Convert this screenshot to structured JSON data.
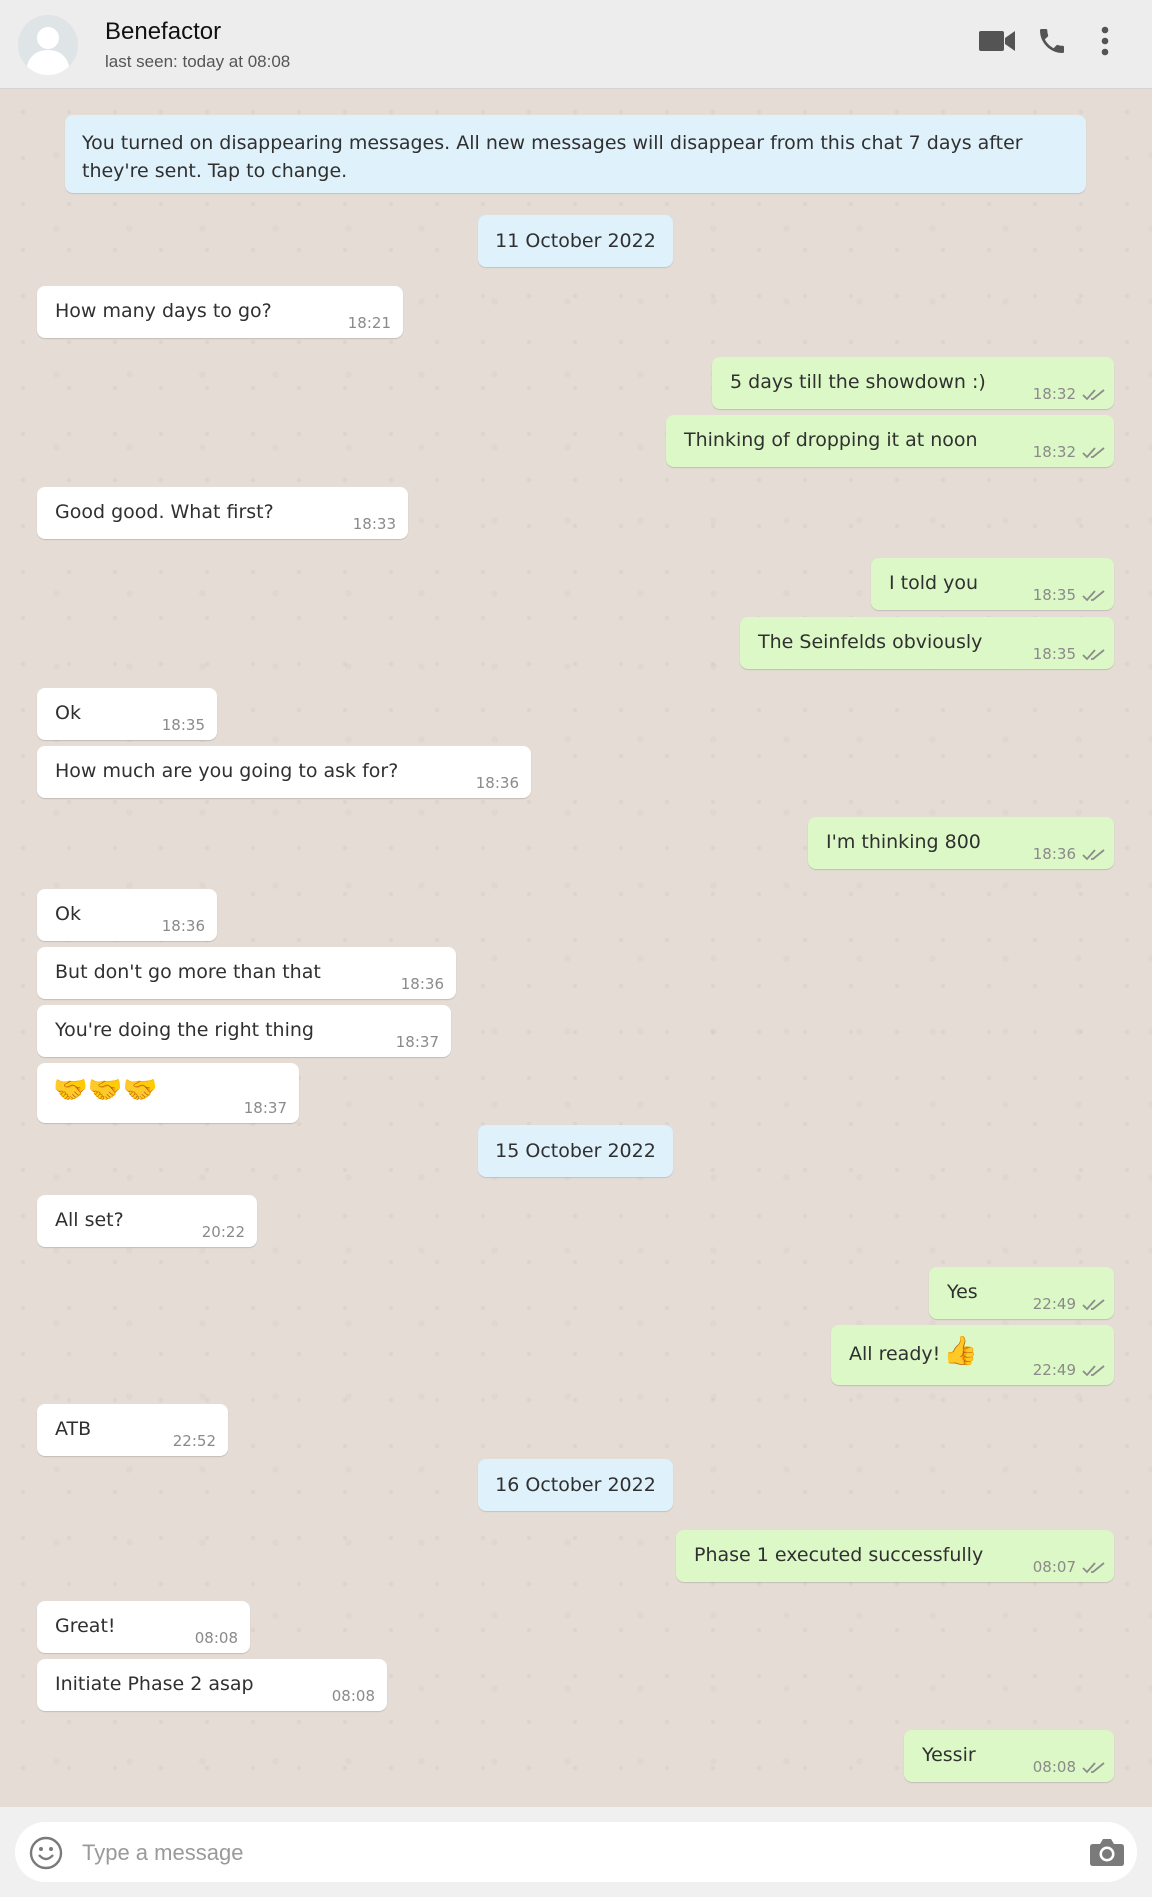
{
  "header": {
    "contact_name": "Benefactor",
    "last_seen": "last seen: today at 08:08",
    "icons": [
      "avatar-placeholder",
      "video-call-icon",
      "voice-call-icon",
      "menu-more-icon"
    ]
  },
  "system_message": "You turned on disappearing messages. All new messages will disappear from this chat 7 days after they're sent. Tap to change.",
  "dates": [
    "11 October 2022",
    "15 October 2022",
    "16 October 2022"
  ],
  "messages": [
    {
      "dir": "in",
      "text": "How many days to go?",
      "time": "18:21"
    },
    {
      "dir": "out",
      "text": "5 days till the showdown :)",
      "time": "18:32",
      "ticks": "double-check"
    },
    {
      "dir": "out",
      "text": "Thinking of dropping it at noon",
      "time": "18:32",
      "ticks": "double-check"
    },
    {
      "dir": "in",
      "text": "Good good. What first?",
      "time": "18:33"
    },
    {
      "dir": "out",
      "text": "I told you",
      "time": "18:35",
      "ticks": "double-check"
    },
    {
      "dir": "out",
      "text": "The Seinfelds obviously",
      "time": "18:35",
      "ticks": "double-check"
    },
    {
      "dir": "in",
      "text": "Ok",
      "time": "18:35"
    },
    {
      "dir": "in",
      "text": "How much are you going to ask for?",
      "time": "18:36"
    },
    {
      "dir": "out",
      "text": "I'm thinking 800",
      "time": "18:36",
      "ticks": "double-check"
    },
    {
      "dir": "in",
      "text": "Ok",
      "time": "18:36"
    },
    {
      "dir": "in",
      "text": "But don't go more than that",
      "time": "18:36"
    },
    {
      "dir": "in",
      "text": "You're doing the right thing",
      "time": "18:37"
    },
    {
      "dir": "in",
      "text": "🤝🤝🤝",
      "time": "18:37"
    },
    {
      "dir": "in",
      "text": "All set?",
      "time": "20:22"
    },
    {
      "dir": "out",
      "text": "Yes",
      "time": "22:49",
      "ticks": "double-check"
    },
    {
      "dir": "out",
      "text": "All ready!",
      "emoji": "👍",
      "time": "22:49",
      "ticks": "double-check"
    },
    {
      "dir": "in",
      "text": "ATB",
      "time": "22:52"
    },
    {
      "dir": "out",
      "text": "Phase 1 executed successfully",
      "time": "08:07",
      "ticks": "double-check"
    },
    {
      "dir": "in",
      "text": "Great!",
      "time": "08:08"
    },
    {
      "dir": "in",
      "text": "Initiate Phase 2 asap",
      "time": "08:08"
    },
    {
      "dir": "out",
      "text": "Yessir",
      "time": "08:08",
      "ticks": "double-check"
    }
  ],
  "input": {
    "placeholder": "Type a message",
    "value": "",
    "icons": [
      "emoji-icon",
      "camera-icon"
    ]
  },
  "colors": {
    "background": "#e5ddd5",
    "outgoing_bubble": "#dcf8c6",
    "incoming_bubble": "#ffffff",
    "system_bubble": "#dff1fa",
    "header": "#ededed"
  }
}
